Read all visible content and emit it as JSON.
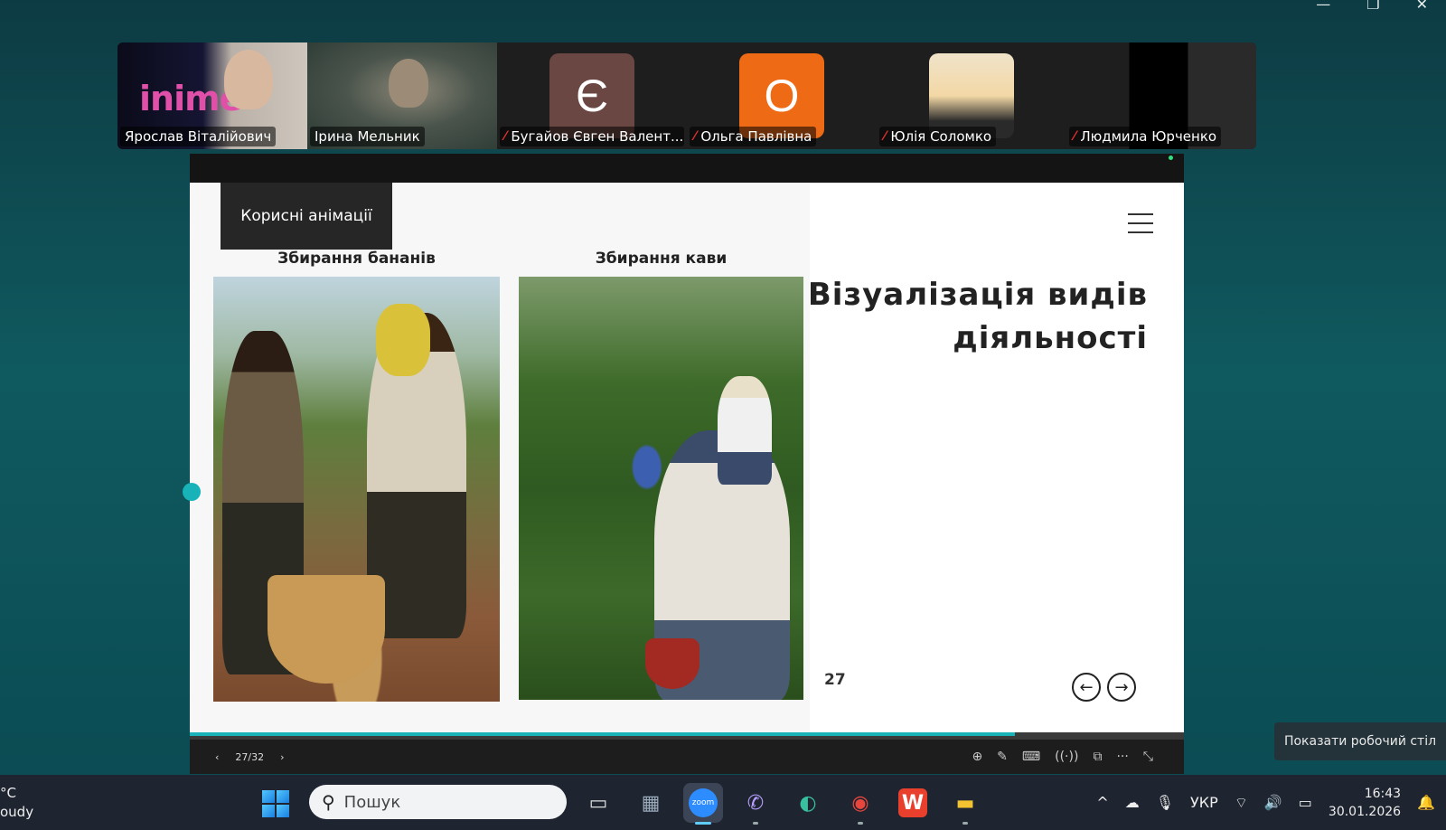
{
  "window_controls": [
    "—",
    "❐",
    "✕"
  ],
  "participants": [
    {
      "name": "Ярослав Віталійович",
      "muted": false,
      "avatar": "",
      "logo": "inime"
    },
    {
      "name": "Ірина Мельник",
      "muted": false,
      "avatar": "",
      "active": true
    },
    {
      "name": "Бугайов Євген Валент...",
      "muted": true,
      "avatar": "Є",
      "color": "#6b4744"
    },
    {
      "name": "Ольга Павлівна",
      "muted": true,
      "avatar": "О",
      "color": "#ee6a14"
    },
    {
      "name": "Юлія Соломко",
      "muted": true,
      "avatar": "",
      "photo": true
    },
    {
      "name": "Людмила Юрченко",
      "muted": true,
      "avatar": ""
    }
  ],
  "slide": {
    "tag": "Корисні анімації",
    "caption_left": "Збирання бананів",
    "caption_right": "Збирання кави",
    "title_line1": "Візуалізація видів",
    "title_line2": "діяльності",
    "page_number": "27",
    "prev_icon": "←",
    "next_icon": "→"
  },
  "share_bar": {
    "prev": "‹",
    "pages": "27/32",
    "next": "›",
    "tools": [
      "⊕",
      "✎",
      "⌨",
      "((·))",
      "⧉",
      "···",
      "⤡"
    ]
  },
  "tooltip": "Показати робочий стіл",
  "taskbar": {
    "weather_temp": "°C",
    "weather_desc": "oudy",
    "search_placeholder": "Пошук",
    "apps": [
      {
        "name": "task-view-icon",
        "glyph": "▭"
      },
      {
        "name": "calculator-icon",
        "glyph": "▦"
      },
      {
        "name": "zoom-icon",
        "glyph": "zoom"
      },
      {
        "name": "viber-icon",
        "glyph": "✆"
      },
      {
        "name": "edge-icon",
        "glyph": "◐"
      },
      {
        "name": "chrome-icon",
        "glyph": "◉"
      },
      {
        "name": "wps-icon",
        "glyph": "W"
      },
      {
        "name": "explorer-icon",
        "glyph": "▬"
      }
    ],
    "tray_chevron": "^",
    "lang": "УКР",
    "time": "16:43",
    "date": "30.01.2026"
  },
  "colors": {
    "accent": "#17b3b8",
    "active_speaker": "#2fe07d",
    "muted": "#e0312e"
  }
}
